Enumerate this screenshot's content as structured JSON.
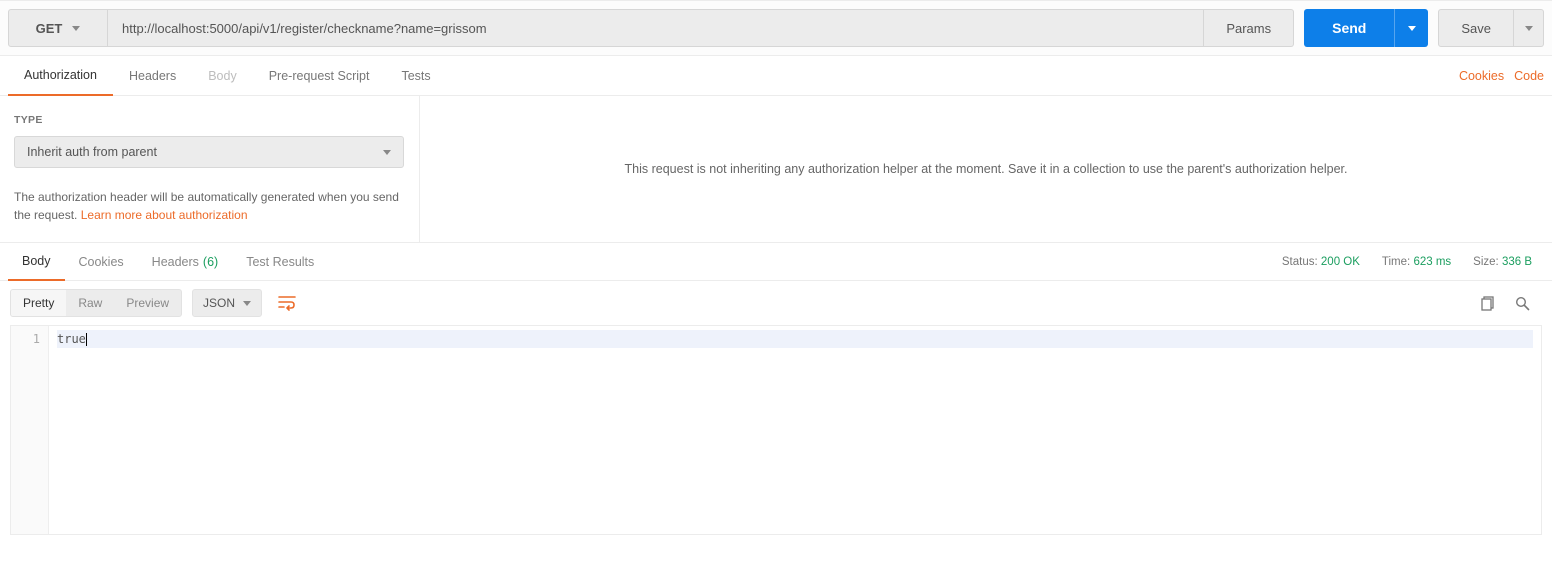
{
  "request": {
    "method": "GET",
    "url": "http://localhost:5000/api/v1/register/checkname?name=grissom",
    "params_btn": "Params",
    "send_btn": "Send",
    "save_btn": "Save"
  },
  "req_tabs": {
    "authorization": "Authorization",
    "headers": "Headers",
    "body": "Body",
    "prerequest": "Pre-request Script",
    "tests": "Tests",
    "cookies_link": "Cookies",
    "code_link": "Code"
  },
  "auth": {
    "type_label": "TYPE",
    "selected": "Inherit auth from parent",
    "help_prefix": "The authorization header will be automatically generated when you send the request. ",
    "help_link": "Learn more about authorization",
    "right_message": "This request is not inheriting any authorization helper at the moment. Save it in a collection to use the parent's authorization helper."
  },
  "resp_tabs": {
    "body": "Body",
    "cookies": "Cookies",
    "headers": "Headers",
    "headers_count": "(6)",
    "test_results": "Test Results"
  },
  "resp_meta": {
    "status_label": "Status:",
    "status_value": "200 OK",
    "time_label": "Time:",
    "time_value": "623 ms",
    "size_label": "Size:",
    "size_value": "336 B"
  },
  "resp_toolbar": {
    "pretty": "Pretty",
    "raw": "Raw",
    "preview": "Preview",
    "format": "JSON"
  },
  "resp_body": {
    "line1_num": "1",
    "line1_text": "true"
  }
}
